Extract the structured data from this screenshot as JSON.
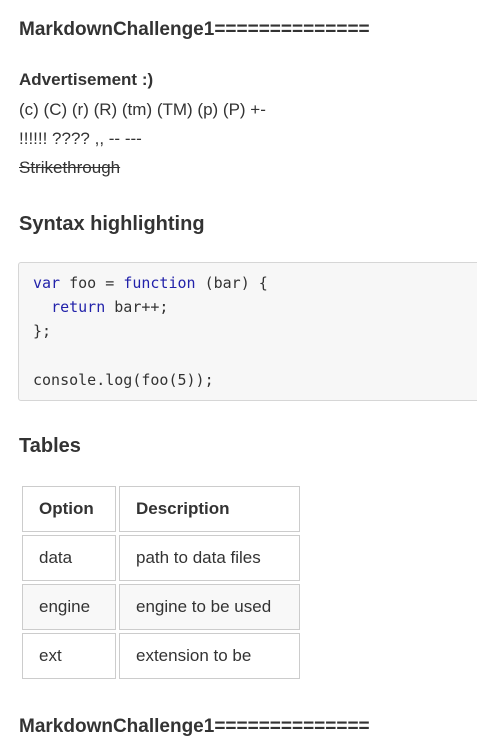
{
  "heading_top": "MarkdownChallenge1==============",
  "advert_heading": "Advertisement :)",
  "typographer_line1": "(c) (C) (r) (R) (tm) (TM) (p) (P) +-",
  "typographer_line2": "!!!!!! ???? ,, -- ---",
  "strikethrough_text": "Strikethrough",
  "syntax_heading": "Syntax highlighting",
  "code": {
    "l1_kw1": "var",
    "l1_a": " foo = ",
    "l1_kw2": "function",
    "l1_b": " (bar) {",
    "l2_indent": "  ",
    "l2_kw": "return",
    "l2_rest": " bar++;",
    "l3": "};",
    "l5": "console.log(foo(5));"
  },
  "tables_heading": "Tables",
  "table": {
    "headers": [
      "Option",
      "Description"
    ],
    "rows": [
      [
        "data",
        "path to data files"
      ],
      [
        "engine",
        "engine to be used"
      ],
      [
        "ext",
        "extension to be"
      ]
    ]
  },
  "heading_bottom": "MarkdownChallenge1=============="
}
